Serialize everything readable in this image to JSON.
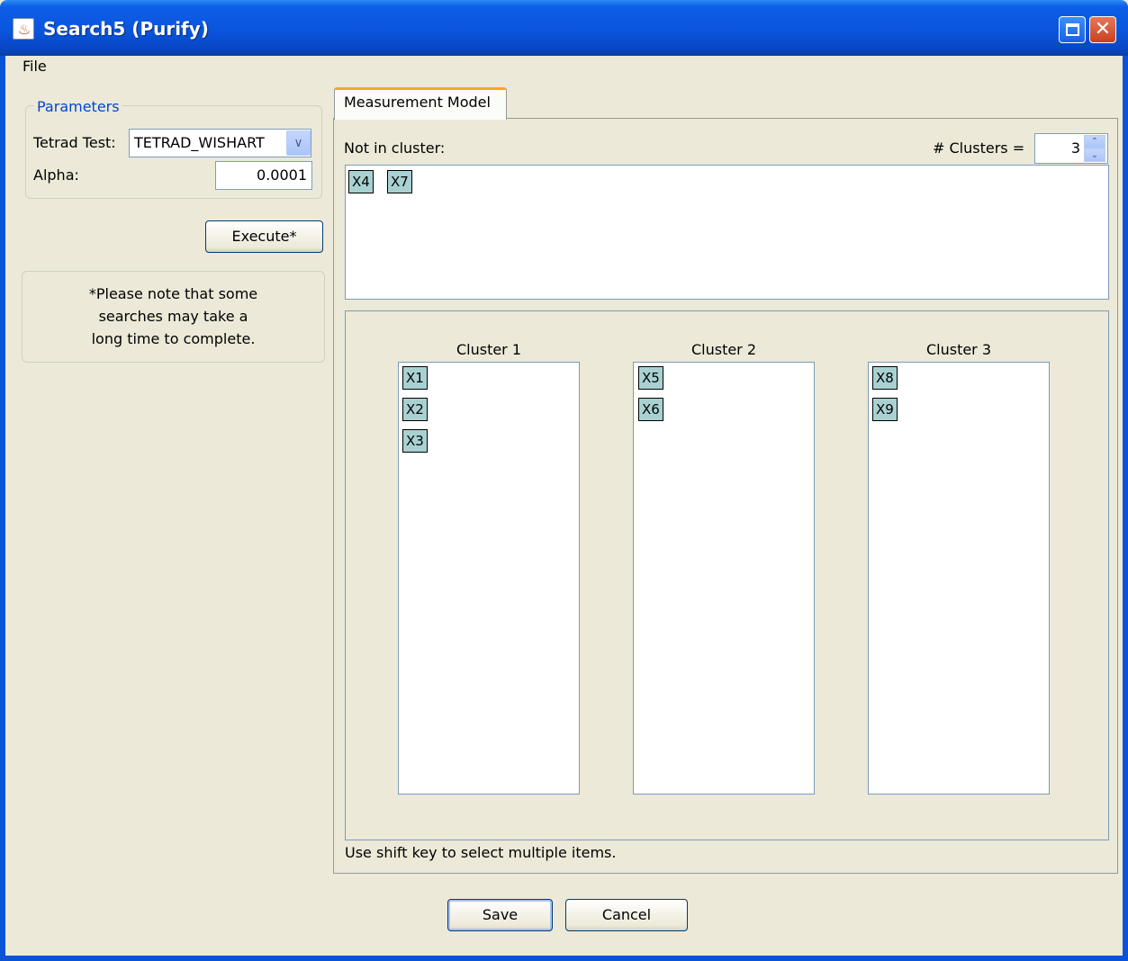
{
  "window": {
    "title": "Search5 (Purify)",
    "app_icon": "java-cup-icon",
    "app_icon_glyph": "♨",
    "restore_icon": "restore-icon",
    "close_icon": "close-icon",
    "close_glyph": "✕"
  },
  "menubar": {
    "items": [
      "File"
    ]
  },
  "parameters": {
    "legend": "Parameters",
    "tetrad_test_label": "Tetrad Test:",
    "tetrad_test_value": "TETRAD_WISHART",
    "dropdown_icon": "chevron-down-icon",
    "dropdown_glyph": "∨",
    "alpha_label": "Alpha:",
    "alpha_value": "0.0001"
  },
  "execute_button": "Execute*",
  "note_lines": [
    "*Please note that some",
    "searches may take a",
    "long time to complete."
  ],
  "tab": {
    "label": "Measurement Model"
  },
  "measurement": {
    "not_in_cluster_label": "Not in cluster:",
    "not_in_cluster_items": [
      "X4",
      "X7"
    ],
    "num_clusters_label": "# Clusters =",
    "num_clusters_value": "3",
    "spin_up_glyph": "⌃",
    "spin_down_glyph": "⌄",
    "clusters": [
      {
        "label": "Cluster 1",
        "items": [
          "X1",
          "X2",
          "X3"
        ]
      },
      {
        "label": "Cluster 2",
        "items": [
          "X5",
          "X6"
        ]
      },
      {
        "label": "Cluster 3",
        "items": [
          "X8",
          "X9"
        ]
      }
    ],
    "hint": "Use shift key to select multiple items."
  },
  "dialog_buttons": {
    "save": "Save",
    "cancel": "Cancel"
  },
  "colors": {
    "title_bar": "#0a55dd",
    "background": "#ece9d8",
    "chip": "#a9d1d1",
    "tab_accent": "#f5a623",
    "legend_text": "#0046d5"
  }
}
